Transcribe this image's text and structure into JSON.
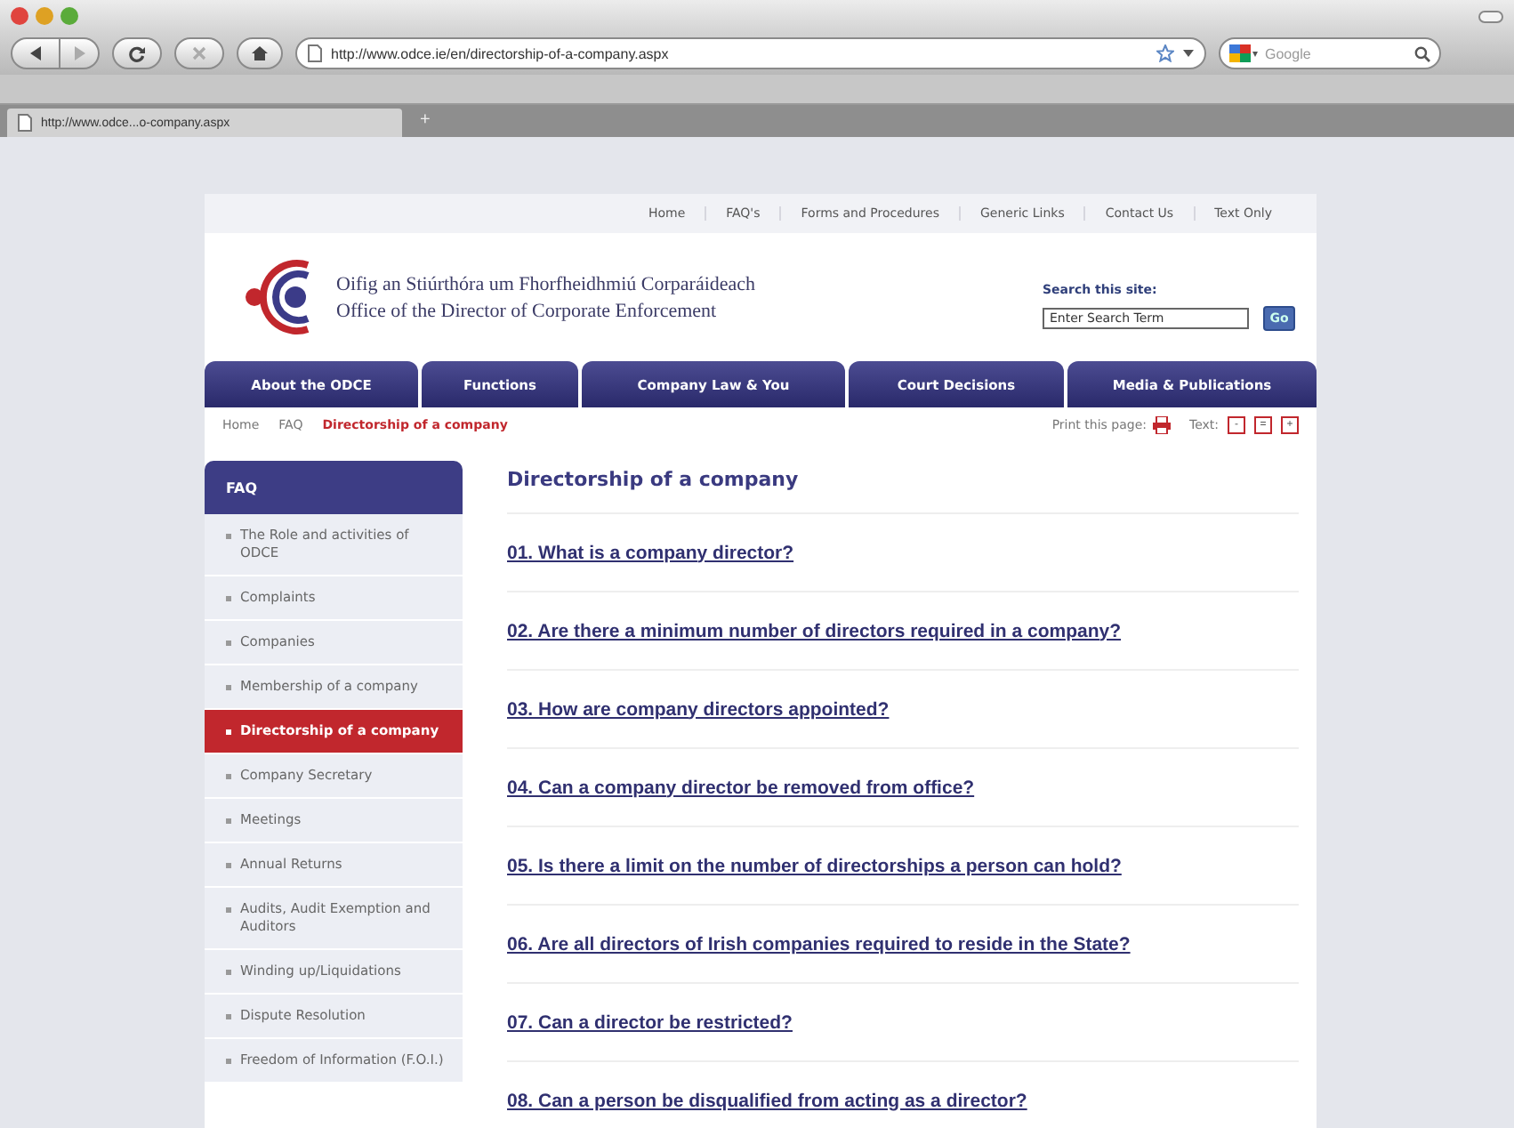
{
  "browser": {
    "url": "http://www.odce.ie/en/directorship-of-a-company.aspx",
    "search_placeholder": "Google",
    "tab": {
      "title": "http://www.odce...o-company.aspx"
    },
    "new_tab": "+"
  },
  "top_links": [
    "Home",
    "FAQ's",
    "Forms and Procedures",
    "Generic Links",
    "Contact Us",
    "Text Only"
  ],
  "site": {
    "name_irish": "Oifig an Stiúrthóra um Fhorfheidhmiú Corparáideach",
    "name_english": "Office of the Director of Corporate Enforcement"
  },
  "search": {
    "label": "Search this site:",
    "placeholder": "Enter Search Term",
    "button": "Go"
  },
  "nav": [
    "About the ODCE",
    "Functions",
    "Company Law & You",
    "Court Decisions",
    "Media & Publications"
  ],
  "breadcrumb": [
    {
      "label": "Home",
      "current": false
    },
    {
      "label": "FAQ",
      "current": false
    },
    {
      "label": "Directorship of a company",
      "current": true
    }
  ],
  "tools": {
    "print_label": "Print this page:",
    "text_label": "Text:",
    "text_buttons": [
      "-",
      "=",
      "+"
    ]
  },
  "sidebar": {
    "title": "FAQ",
    "items": [
      {
        "label": "The Role and activities of ODCE",
        "selected": false
      },
      {
        "label": "Complaints",
        "selected": false
      },
      {
        "label": "Companies",
        "selected": false
      },
      {
        "label": "Membership of a company",
        "selected": false
      },
      {
        "label": "Directorship of a company",
        "selected": true
      },
      {
        "label": "Company Secretary",
        "selected": false
      },
      {
        "label": "Meetings",
        "selected": false
      },
      {
        "label": "Annual Returns",
        "selected": false
      },
      {
        "label": "Audits, Audit Exemption and Auditors",
        "selected": false
      },
      {
        "label": "Winding up/Liquidations",
        "selected": false
      },
      {
        "label": "Dispute Resolution",
        "selected": false
      },
      {
        "label": "Freedom of Information (F.O.I.)",
        "selected": false
      }
    ]
  },
  "content": {
    "title": "Directorship of a company",
    "questions": [
      "01. What is a company director?",
      "02. Are there a minimum number of directors required in a company?",
      "03. How are company directors appointed?",
      "04. Can a company director be removed from office?",
      "05. Is there a limit on the number of directorships a person can hold?",
      "06. Are all directors of Irish companies required to reside in the State?",
      "07. Can a director be restricted?",
      "08. Can a person be disqualified from acting as a director?"
    ]
  }
}
